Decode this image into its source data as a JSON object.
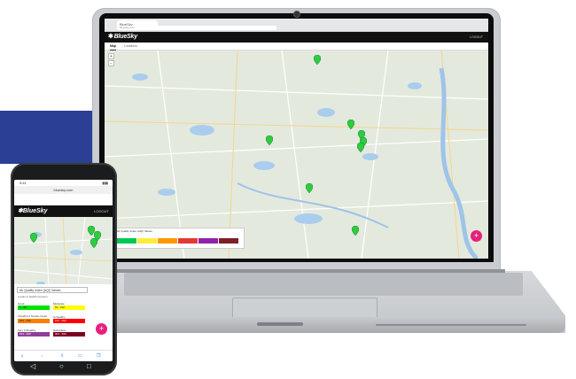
{
  "laptop": {
    "browser_tab": "BlueSky",
    "url": "bluesky.com",
    "logo_text": "BlueSky",
    "logout": "LOGOUT",
    "tabs": [
      {
        "label": "Map",
        "active": true
      },
      {
        "label": "Locations",
        "active": false
      }
    ],
    "zoom_in": "+",
    "zoom_out": "−",
    "fab": "+",
    "legend_title": "Air Quality Index (AQI) Values",
    "legend_colors": [
      "#00c853",
      "#ffeb3b",
      "#ff9800",
      "#e53935",
      "#8e24aa",
      "#7b1f2b"
    ]
  },
  "phone": {
    "time": "9:41",
    "url": "bluesky.com",
    "logo_text": "BlueSky",
    "logout": "LOGOUT",
    "panel_select": "Air Quality Index (AQI) Values",
    "panel_sub": "Levels of Health Concern",
    "aqi_levels": [
      {
        "label": "Good",
        "range": "0 - 50",
        "color": "#00e400"
      },
      {
        "label": "Moderate",
        "range": "51 - 100",
        "color": "#ffff00"
      },
      {
        "label": "Unhealthy for Sensitive Groups",
        "range": "101 - 150",
        "color": "#ff7e00"
      },
      {
        "label": "Unhealthy",
        "range": "151 - 200",
        "color": "#ff0000"
      },
      {
        "label": "Very Unhealthy",
        "range": "201 - 300",
        "color": "#8f3f97"
      },
      {
        "label": "Hazardous",
        "range": "301 - 500",
        "color": "#7e0023"
      }
    ],
    "fab": "+"
  },
  "colors": {
    "brand_blue": "#2b3f95",
    "header_black": "#111111",
    "fab_pink": "#e6217c",
    "marker_green": "#2ecc40"
  }
}
